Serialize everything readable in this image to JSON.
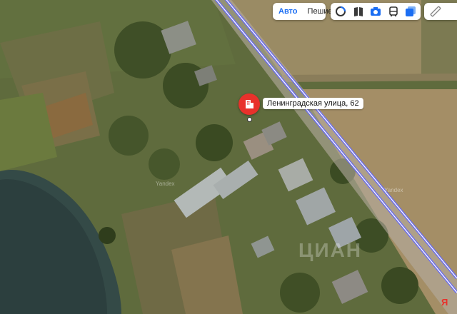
{
  "toolbar": {
    "modes": [
      {
        "label": "Авто",
        "active": true
      },
      {
        "label": "Пешие",
        "active": false
      }
    ],
    "layer_icons": [
      "panorama-icon",
      "map-book-icon",
      "camera-icon",
      "bus-icon",
      "layers-icon"
    ],
    "ruler_icon": "ruler-icon"
  },
  "marker": {
    "address": "Ленинградская улица, 62",
    "icon": "building-icon",
    "color": "#e8312b"
  },
  "watermarks": {
    "yandex_1": "Yandex",
    "yandex_2": "Yandex",
    "cian": "ЦИАН"
  },
  "logo": "Я",
  "colors": {
    "road_line": "#6a6cf0",
    "accent": "#1b6ef3"
  }
}
